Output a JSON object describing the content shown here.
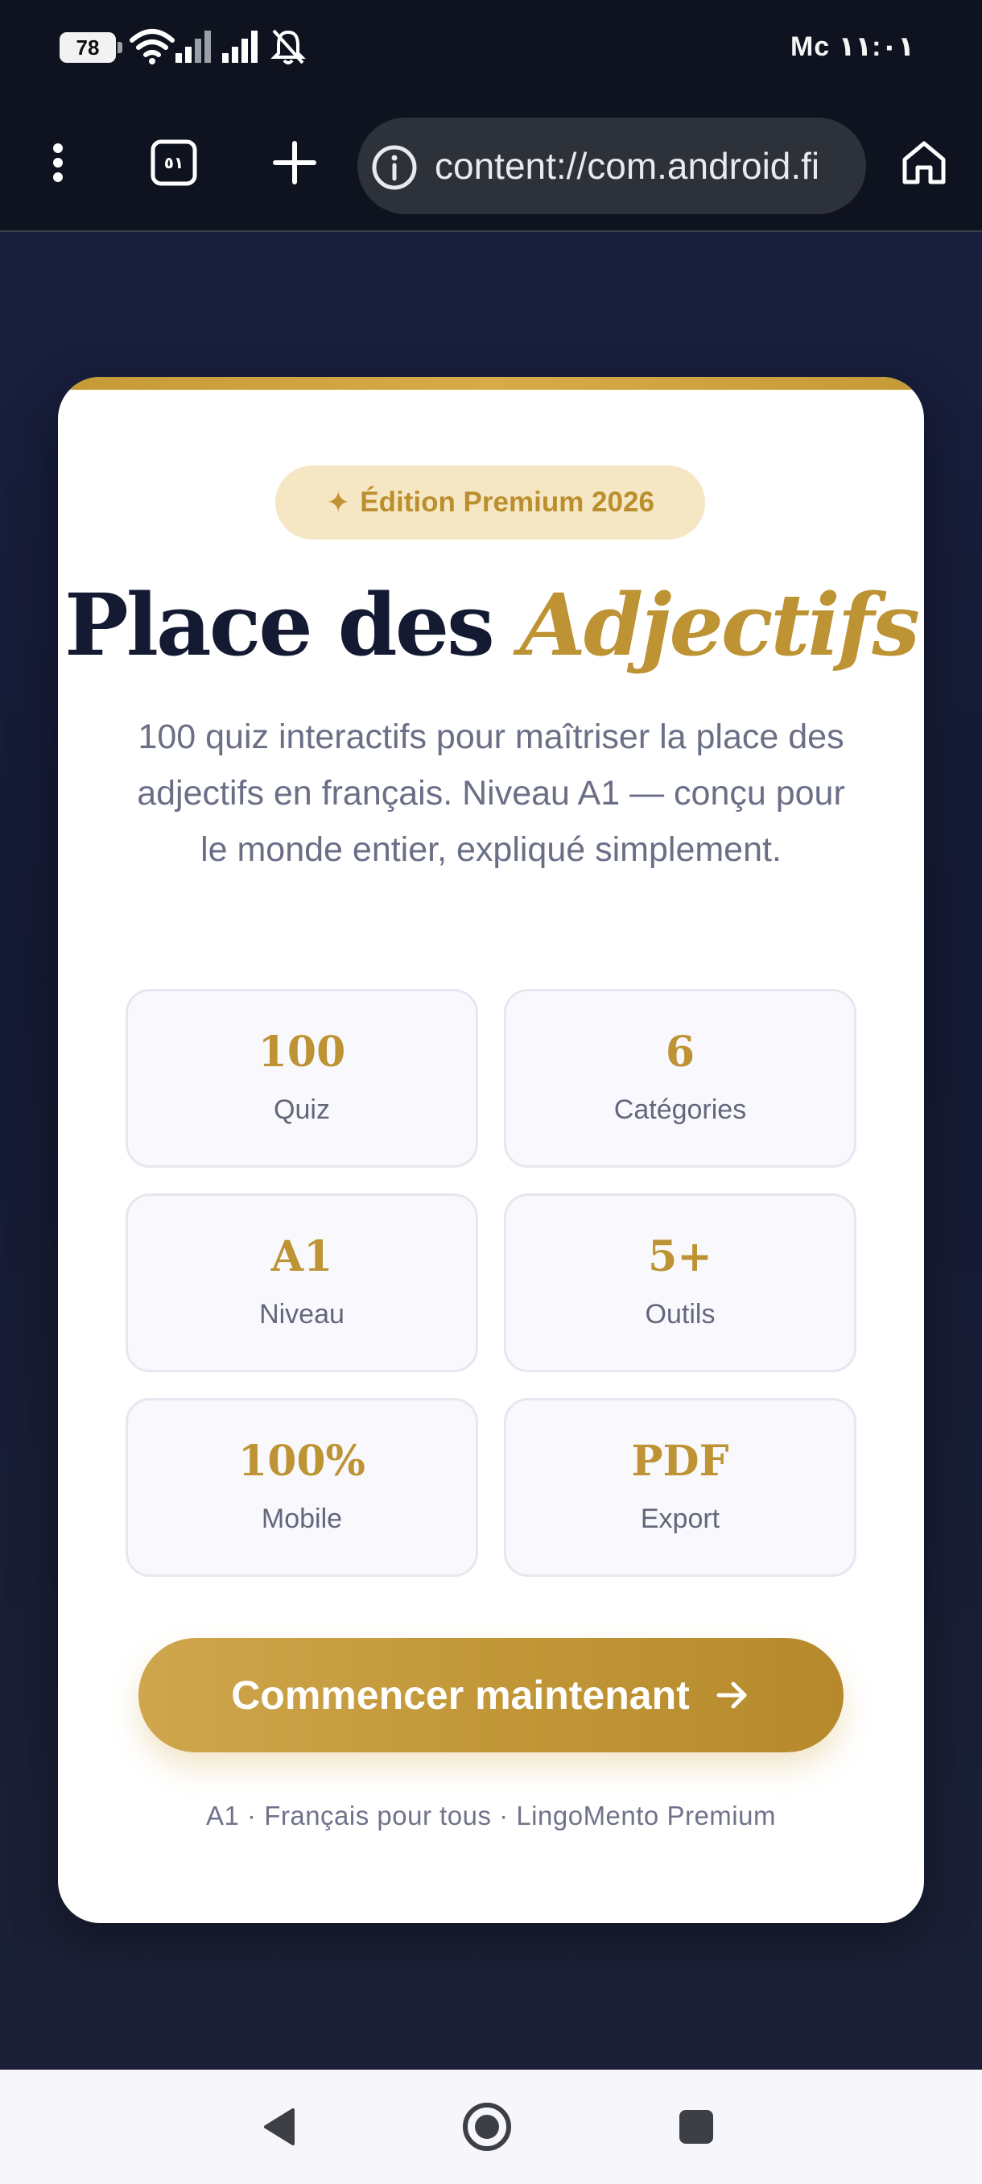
{
  "status_bar": {
    "battery_level": "78",
    "time": "Mc ١١:٠١",
    "icons": [
      "wifi-icon",
      "signal-icon",
      "signal-icon",
      "bell-off-icon"
    ]
  },
  "browser": {
    "tab_count": "٥١",
    "url": "content://com.android.fi",
    "icons": [
      "more-vert-icon",
      "tabs-icon",
      "plus-icon",
      "info-icon",
      "home-icon"
    ]
  },
  "card": {
    "badge": "Édition Premium 2026",
    "title_part1": "Place des ",
    "title_part2": "Adjectifs",
    "subtitle": "100 quiz interactifs pour maîtriser la place des adjectifs en français. Niveau A1 — conçu pour le monde entier, expliqué simplement.",
    "stats": [
      {
        "value": "100",
        "label": "Quiz"
      },
      {
        "value": "6",
        "label": "Catégories"
      },
      {
        "value": "A1",
        "label": "Niveau"
      },
      {
        "value": "5+",
        "label": "Outils"
      },
      {
        "value": "100%",
        "label": "Mobile"
      },
      {
        "value": "PDF",
        "label": "Export"
      }
    ],
    "cta_label": "Commencer maintenant",
    "footer": "A1 · Français pour tous · LingoMento Premium"
  },
  "colors": {
    "accent_gold": "#bd9334",
    "title_navy": "#151a33",
    "badge_bg": "#f6e7c4",
    "page_bg": "#1a2040"
  }
}
